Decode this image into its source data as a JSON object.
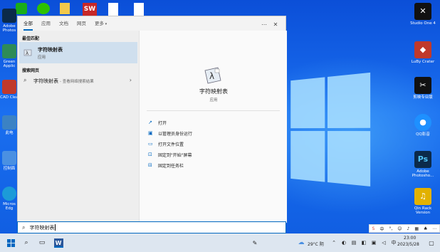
{
  "start_menu": {
    "tabs": [
      "全部",
      "应用",
      "文档",
      "网页",
      "更多"
    ],
    "best_match_heading": "最佳匹配",
    "best_match": {
      "title": "字符映射表",
      "subtitle": "应用"
    },
    "web_heading": "搜索网页",
    "web_result": {
      "title": "字符映射表",
      "hint": "- 查看网络搜索结果"
    },
    "detail": {
      "title": "字符映射表",
      "subtitle": "应用"
    },
    "actions": [
      "打开",
      "以管理员身份运行",
      "打开文件位置",
      "固定到\"开始\"屏幕",
      "固定到任务栏"
    ]
  },
  "search_box": {
    "value": "字符映射表"
  },
  "desktop_right_icons": [
    {
      "label": "Studio One 4",
      "icon": "studio-one-icon",
      "color": "#ffffff"
    },
    {
      "label": "LuBy Crater",
      "icon": "luby-crater-icon",
      "color": "#c0392b"
    },
    {
      "label": "剪映专业版",
      "icon": "jianying-icon",
      "color": "#111111"
    },
    {
      "label": "QQ影音",
      "icon": "qq-player-icon",
      "color": "#1e90ff"
    },
    {
      "label": "Adobe Photosho...",
      "icon": "photoshop-icon",
      "color": "#0b2a4a"
    },
    {
      "label": "Qin Rack Version",
      "icon": "qin-rack-icon",
      "color": "#e2b100"
    }
  ],
  "desktop_left_icons": [
    {
      "label": "Adobe Photos",
      "color": "#0b2a4a"
    },
    {
      "label": "Green Applic",
      "color": "#2e8b57"
    },
    {
      "label": "CAD Clea",
      "color": "#c0392b"
    },
    {
      "label": "此电",
      "color": "#3b82c4"
    },
    {
      "label": "控制面",
      "color": "#4a90e2"
    },
    {
      "label": "Micros Edg",
      "color": "#1c9bd8"
    }
  ],
  "taskbar": {
    "weather": "29°C 阴",
    "ime_lang": "中",
    "time": "23:00",
    "date": "2023/5/28"
  },
  "colors": {
    "accent": "#0067c0",
    "selection": "#cfdfee"
  }
}
